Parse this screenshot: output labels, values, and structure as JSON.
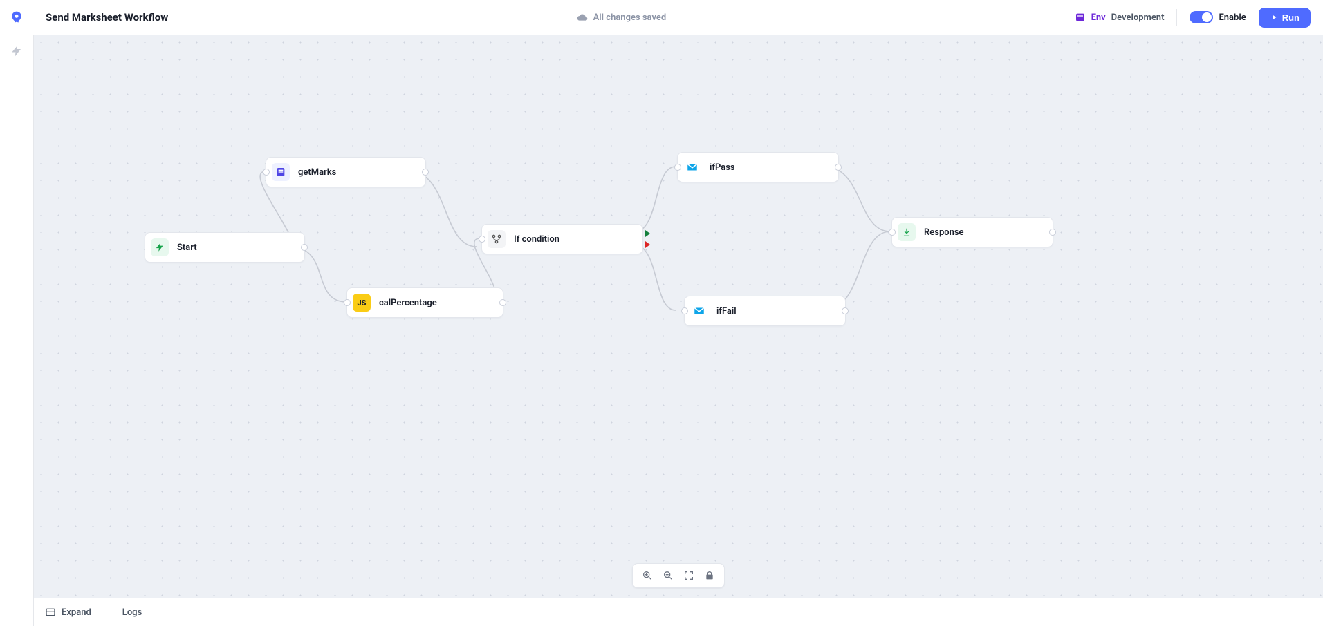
{
  "header": {
    "title": "Send Marksheet Workflow",
    "save_status": "All changes saved",
    "env_label": "Env",
    "env_value": "Development",
    "enable_label": "Enable",
    "run_label": "Run"
  },
  "nodes": {
    "start": {
      "label": "Start"
    },
    "getMarks": {
      "label": "getMarks"
    },
    "calPercentage": {
      "label": "calPercentage",
      "js_badge": "JS"
    },
    "ifCondition": {
      "label": "If condition"
    },
    "ifPass": {
      "label": "ifPass"
    },
    "ifFail": {
      "label": "ifFail"
    },
    "response": {
      "label": "Response"
    }
  },
  "bottom": {
    "expand": "Expand",
    "logs": "Logs"
  }
}
